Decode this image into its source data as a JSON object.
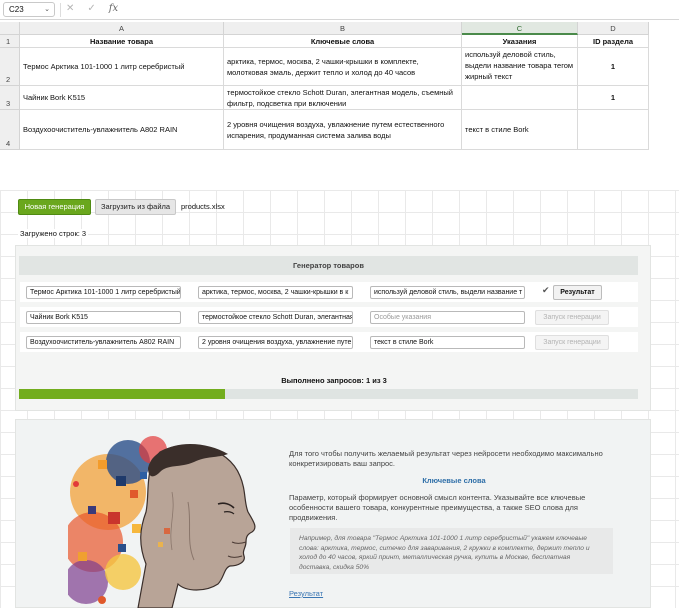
{
  "formula_bar": {
    "cell_ref": "C23",
    "fx": "fx"
  },
  "sheet": {
    "columns": [
      "A",
      "B",
      "C",
      "D"
    ],
    "rows": [
      "1",
      "2",
      "3",
      "4"
    ],
    "header": [
      "Название товара",
      "Ключевые слова",
      "Указания",
      "ID раздела"
    ],
    "data": [
      [
        "Термос Арктика 101-1000 1 литр серебристый",
        "арктика, термос, москва, 2 чашки-крышки в комплекте, молотковая эмаль, держит тепло и холод до 40 часов",
        "используй деловой стиль, выдели название товара тегом жирный текст",
        "1"
      ],
      [
        "Чайник Bork K515",
        "термостойкое стекло Schott Duran, элегантная модель, съемный фильтр, подсветка при включении",
        "",
        "1"
      ],
      [
        "Воздухоочиститель-увлажнитель A802 RAIN",
        "2 уровня очищения воздуха, увлажнение путем естественного испарения, продуманная система залива воды",
        "текст в стиле Bork",
        ""
      ]
    ]
  },
  "app": {
    "new_button": "Новая генерация",
    "load_button": "Загрузить из файла",
    "filename": "products.xlsx",
    "loaded_rows": "Загружено строк: 3",
    "generator": {
      "title": "Генератор товаров",
      "rows": [
        {
          "name": "Термос Арктика 101-1000 1 литр серебристый",
          "keywords": "арктика, термос, москва, 2 чашки-крышки в к",
          "instructions": "используй деловой стиль, выдели название т",
          "instructions_placeholder": "",
          "button": "Результат",
          "status": "done"
        },
        {
          "name": "Чайник Bork K515",
          "keywords": "термостойкое стекло Schott Duran, элегантная",
          "instructions": "",
          "instructions_placeholder": "Особые указания",
          "button": "Запуск генерации",
          "status": "disabled"
        },
        {
          "name": "Воздухоочиститель-увлажнитель A802 RAIN",
          "keywords": "2 уровня очищения воздуха, увлажнение путе",
          "instructions": "текст в стиле Bork",
          "instructions_placeholder": "",
          "button": "Запуск генерации",
          "status": "disabled"
        }
      ],
      "progress_text": "Выполнено запросов: 1 из 3",
      "progress_done": 1,
      "progress_total": 3
    },
    "info": {
      "intro": "Для того чтобы получить желаемый результат через нейросети необходимо максимально конкретизировать ваш запрос.",
      "subtitle": "Ключевые слова",
      "paragraph": "Параметр, который формирует основной смысл контента. Указывайте все ключевые особенности вашего товара, конкурентные преимущества, а также SEO слова для продвижения.",
      "example": "Например, для товара \"Термос Арктика 101-1000 1 литр серебристый\" укажем ключевые слова: арктика, термос, ситечко для заваривания, 2 кружки в комплекте, держит тепло и холод до 40 часов, яркий принт, металлическая ручка, купить в Москве, бесплатная доставка, скидка 50%",
      "result_link": "Результат"
    }
  },
  "colors": {
    "accent_green": "#72ad1d",
    "link_blue": "#3a76b3"
  }
}
